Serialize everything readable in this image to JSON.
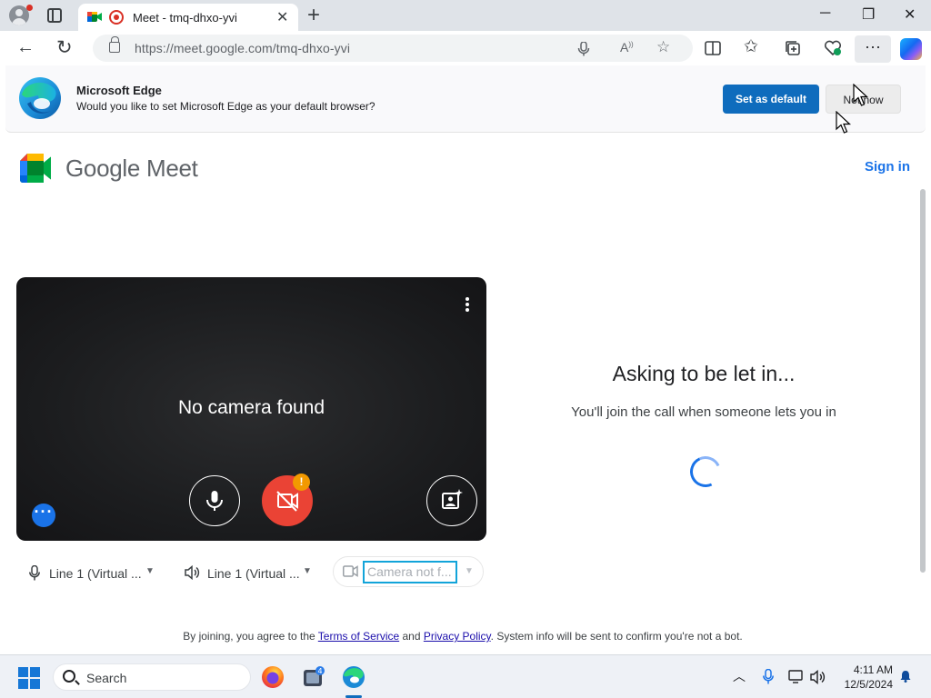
{
  "browser": {
    "tab_title": "Meet - tmq-dhxo-yvi",
    "tab_close": "✕",
    "new_tab": "+",
    "url": "https://meet.google.com/tmq-dhxo-yvi",
    "window_minimize": "─",
    "window_restore": "❐",
    "window_close": "✕"
  },
  "infobar": {
    "title": "Microsoft Edge",
    "message": "Would you like to set Microsoft Edge as your default browser?",
    "set_default_label": "Set as default",
    "not_now_label": "Not now"
  },
  "meet": {
    "brand": "Google Meet",
    "sign_in": "Sign in",
    "no_camera": "No camera found",
    "warning_badge": "!",
    "mic_select": "Line 1 (Virtual ...",
    "speaker_select": "Line 1 (Virtual ...",
    "camera_select": "Camera not f...",
    "asking_title": "Asking to be let in...",
    "asking_subtitle": "You'll join the call when someone lets you in",
    "terms_prefix": "By joining, you agree to the ",
    "terms_link": "Terms of Service",
    "terms_and": " and ",
    "privacy_link": "Privacy Policy",
    "terms_suffix": ". System info will be sent to confirm you're not a bot."
  },
  "taskbar": {
    "search_label": "Search",
    "time": "4:11 AM",
    "date": "12/5/2024"
  },
  "colors": {
    "accent_blue": "#1a73e8",
    "edge_blue": "#0f6cbd",
    "camera_off_red": "#ea4335",
    "warning_orange": "#f29900",
    "focus_cyan": "#12a4d9"
  }
}
